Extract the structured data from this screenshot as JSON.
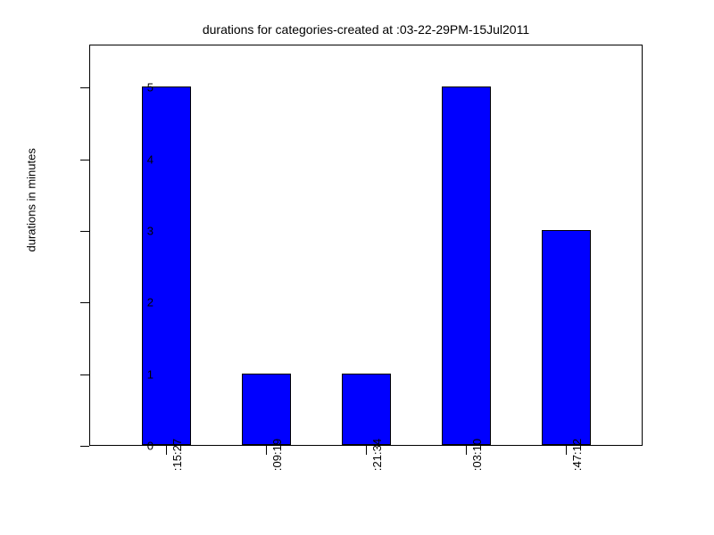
{
  "chart_data": {
    "type": "bar",
    "title": "durations for categories-created at :03-22-29PM-15Jul2011",
    "ylabel": "durations in  minutes",
    "xlabel": "",
    "ylim": [
      0,
      5.6
    ],
    "categories": [
      ":15:27",
      ":09:19",
      ":21:34",
      ":03:10",
      ":47:12"
    ],
    "values": [
      5,
      1,
      1,
      5,
      3
    ],
    "y_ticks": [
      0,
      1,
      2,
      3,
      4,
      5
    ]
  }
}
